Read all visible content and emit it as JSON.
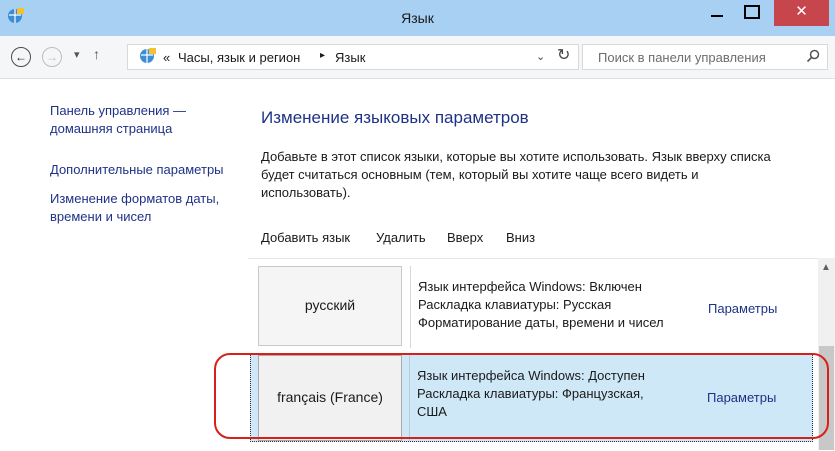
{
  "window": {
    "title": "Язык",
    "close_label": "✕"
  },
  "address": {
    "breadcrumb_sep": "«",
    "segment1": "Часы, язык и регион",
    "arrow": "▸",
    "segment2": "Язык",
    "dropdown": "⌄",
    "refresh": "↻"
  },
  "search": {
    "placeholder": "Поиск в панели управления"
  },
  "sidebar": {
    "items": [
      {
        "label_line1": "Панель управления —",
        "label_line2": "домашняя страница"
      },
      {
        "label_line1": "Дополнительные параметры"
      },
      {
        "label_line1": "Изменение форматов даты,",
        "label_line2": "времени и чисел"
      }
    ]
  },
  "main": {
    "heading": "Изменение языковых параметров",
    "description_line1": "Добавьте в этот список языки, которые вы хотите использовать. Язык вверху списка",
    "description_line2": "будет считаться основным (тем, который вы хотите чаще всего видеть и",
    "description_line3": "использовать).",
    "toolbar": {
      "add": "Добавить язык",
      "remove": "Удалить",
      "up": "Вверх",
      "down": "Вниз"
    },
    "languages": [
      {
        "name": "русский",
        "info": [
          "Язык интерфейса Windows: Включен",
          "Раскладка клавиатуры: Русская",
          "Форматирование даты, времени и чисел"
        ],
        "options": "Параметры",
        "selected": false
      },
      {
        "name": "français (France)",
        "info": [
          "Язык интерфейса Windows: Доступен",
          "Раскладка клавиатуры: Французская,",
          "США"
        ],
        "options": "Параметры",
        "selected": true
      }
    ]
  },
  "colors": {
    "titlebar": "#a7d0f3",
    "close_button": "#c7454c",
    "link": "#1e3287",
    "selected_row": "#cfe8f7",
    "highlight_ring": "#d8201b"
  }
}
